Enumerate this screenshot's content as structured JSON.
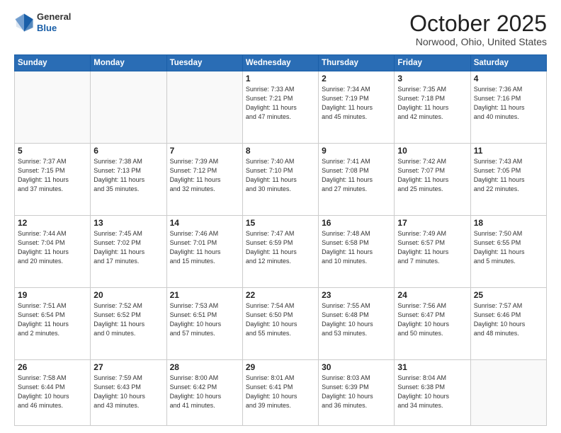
{
  "logo": {
    "general": "General",
    "blue": "Blue"
  },
  "header": {
    "month": "October 2025",
    "location": "Norwood, Ohio, United States"
  },
  "weekdays": [
    "Sunday",
    "Monday",
    "Tuesday",
    "Wednesday",
    "Thursday",
    "Friday",
    "Saturday"
  ],
  "weeks": [
    [
      {
        "day": "",
        "info": ""
      },
      {
        "day": "",
        "info": ""
      },
      {
        "day": "",
        "info": ""
      },
      {
        "day": "1",
        "info": "Sunrise: 7:33 AM\nSunset: 7:21 PM\nDaylight: 11 hours\nand 47 minutes."
      },
      {
        "day": "2",
        "info": "Sunrise: 7:34 AM\nSunset: 7:19 PM\nDaylight: 11 hours\nand 45 minutes."
      },
      {
        "day": "3",
        "info": "Sunrise: 7:35 AM\nSunset: 7:18 PM\nDaylight: 11 hours\nand 42 minutes."
      },
      {
        "day": "4",
        "info": "Sunrise: 7:36 AM\nSunset: 7:16 PM\nDaylight: 11 hours\nand 40 minutes."
      }
    ],
    [
      {
        "day": "5",
        "info": "Sunrise: 7:37 AM\nSunset: 7:15 PM\nDaylight: 11 hours\nand 37 minutes."
      },
      {
        "day": "6",
        "info": "Sunrise: 7:38 AM\nSunset: 7:13 PM\nDaylight: 11 hours\nand 35 minutes."
      },
      {
        "day": "7",
        "info": "Sunrise: 7:39 AM\nSunset: 7:12 PM\nDaylight: 11 hours\nand 32 minutes."
      },
      {
        "day": "8",
        "info": "Sunrise: 7:40 AM\nSunset: 7:10 PM\nDaylight: 11 hours\nand 30 minutes."
      },
      {
        "day": "9",
        "info": "Sunrise: 7:41 AM\nSunset: 7:08 PM\nDaylight: 11 hours\nand 27 minutes."
      },
      {
        "day": "10",
        "info": "Sunrise: 7:42 AM\nSunset: 7:07 PM\nDaylight: 11 hours\nand 25 minutes."
      },
      {
        "day": "11",
        "info": "Sunrise: 7:43 AM\nSunset: 7:05 PM\nDaylight: 11 hours\nand 22 minutes."
      }
    ],
    [
      {
        "day": "12",
        "info": "Sunrise: 7:44 AM\nSunset: 7:04 PM\nDaylight: 11 hours\nand 20 minutes."
      },
      {
        "day": "13",
        "info": "Sunrise: 7:45 AM\nSunset: 7:02 PM\nDaylight: 11 hours\nand 17 minutes."
      },
      {
        "day": "14",
        "info": "Sunrise: 7:46 AM\nSunset: 7:01 PM\nDaylight: 11 hours\nand 15 minutes."
      },
      {
        "day": "15",
        "info": "Sunrise: 7:47 AM\nSunset: 6:59 PM\nDaylight: 11 hours\nand 12 minutes."
      },
      {
        "day": "16",
        "info": "Sunrise: 7:48 AM\nSunset: 6:58 PM\nDaylight: 11 hours\nand 10 minutes."
      },
      {
        "day": "17",
        "info": "Sunrise: 7:49 AM\nSunset: 6:57 PM\nDaylight: 11 hours\nand 7 minutes."
      },
      {
        "day": "18",
        "info": "Sunrise: 7:50 AM\nSunset: 6:55 PM\nDaylight: 11 hours\nand 5 minutes."
      }
    ],
    [
      {
        "day": "19",
        "info": "Sunrise: 7:51 AM\nSunset: 6:54 PM\nDaylight: 11 hours\nand 2 minutes."
      },
      {
        "day": "20",
        "info": "Sunrise: 7:52 AM\nSunset: 6:52 PM\nDaylight: 11 hours\nand 0 minutes."
      },
      {
        "day": "21",
        "info": "Sunrise: 7:53 AM\nSunset: 6:51 PM\nDaylight: 10 hours\nand 57 minutes."
      },
      {
        "day": "22",
        "info": "Sunrise: 7:54 AM\nSunset: 6:50 PM\nDaylight: 10 hours\nand 55 minutes."
      },
      {
        "day": "23",
        "info": "Sunrise: 7:55 AM\nSunset: 6:48 PM\nDaylight: 10 hours\nand 53 minutes."
      },
      {
        "day": "24",
        "info": "Sunrise: 7:56 AM\nSunset: 6:47 PM\nDaylight: 10 hours\nand 50 minutes."
      },
      {
        "day": "25",
        "info": "Sunrise: 7:57 AM\nSunset: 6:46 PM\nDaylight: 10 hours\nand 48 minutes."
      }
    ],
    [
      {
        "day": "26",
        "info": "Sunrise: 7:58 AM\nSunset: 6:44 PM\nDaylight: 10 hours\nand 46 minutes."
      },
      {
        "day": "27",
        "info": "Sunrise: 7:59 AM\nSunset: 6:43 PM\nDaylight: 10 hours\nand 43 minutes."
      },
      {
        "day": "28",
        "info": "Sunrise: 8:00 AM\nSunset: 6:42 PM\nDaylight: 10 hours\nand 41 minutes."
      },
      {
        "day": "29",
        "info": "Sunrise: 8:01 AM\nSunset: 6:41 PM\nDaylight: 10 hours\nand 39 minutes."
      },
      {
        "day": "30",
        "info": "Sunrise: 8:03 AM\nSunset: 6:39 PM\nDaylight: 10 hours\nand 36 minutes."
      },
      {
        "day": "31",
        "info": "Sunrise: 8:04 AM\nSunset: 6:38 PM\nDaylight: 10 hours\nand 34 minutes."
      },
      {
        "day": "",
        "info": ""
      }
    ]
  ]
}
